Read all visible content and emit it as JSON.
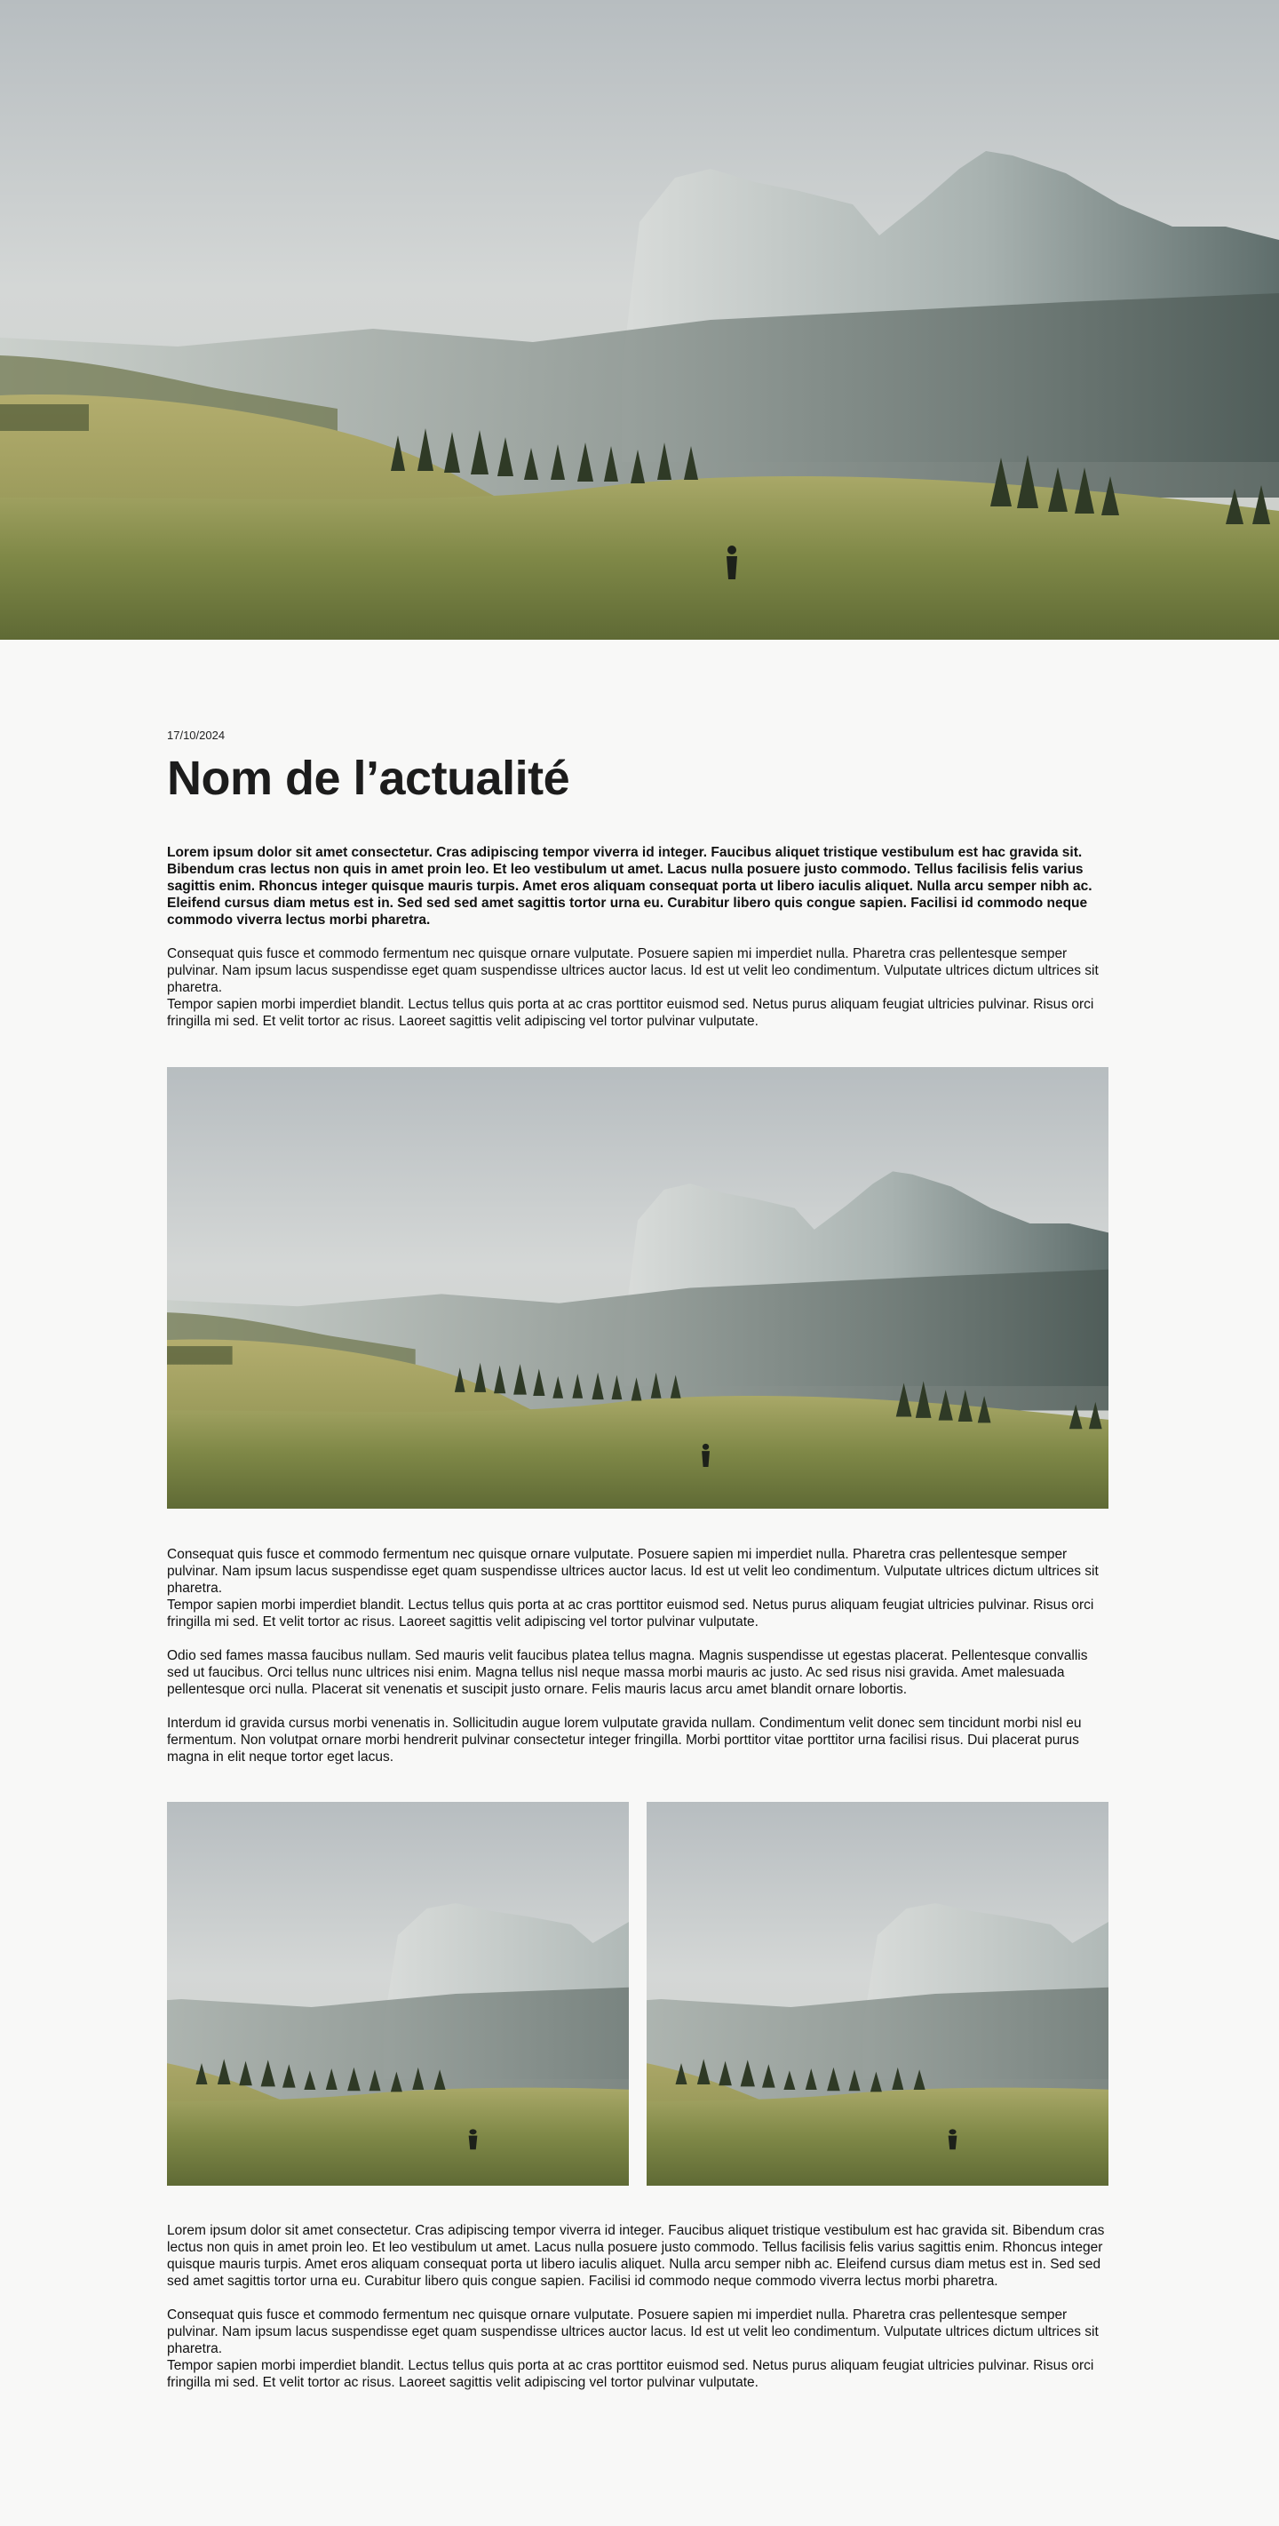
{
  "hero": {
    "image": "mountain-meadow-landscape-photo"
  },
  "article": {
    "date": "17/10/2024",
    "title": "Nom de l’actualité",
    "lead": "Lorem ipsum dolor sit amet consectetur. Cras adipiscing tempor viverra id integer. Faucibus aliquet tristique vestibulum est hac gravida sit. Bibendum cras lectus non quis in amet proin leo. Et leo vestibulum ut amet. Lacus nulla posuere justo commodo. Tellus facilisis felis varius sagittis enim. Rhoncus integer quisque mauris turpis. Amet eros aliquam consequat porta ut libero iaculis aliquet. Nulla arcu semper nibh ac. Eleifend cursus diam metus est in. Sed sed sed amet sagittis tortor urna eu. Curabitur libero quis congue sapien. Facilisi id commodo neque commodo viverra lectus morbi pharetra.",
    "block1": [
      "Consequat quis fusce et commodo fermentum nec quisque ornare vulputate. Posuere sapien mi imperdiet nulla. Pharetra cras pellentesque semper pulvinar. Nam ipsum lacus suspendisse eget quam suspendisse ultrices auctor lacus. Id est ut velit leo condimentum. Vulputate ultrices dictum ultrices sit pharetra.",
      "Tempor sapien morbi imperdiet blandit. Lectus tellus quis porta at ac cras porttitor euismod sed. Netus purus aliquam feugiat ultricies pulvinar. Risus orci fringilla mi sed. Et velit tortor ac risus. Laoreet sagittis velit adipiscing vel tortor pulvinar vulputate."
    ],
    "block2": [
      "Consequat quis fusce et commodo fermentum nec quisque ornare vulputate. Posuere sapien mi imperdiet nulla. Pharetra cras pellentesque semper pulvinar. Nam ipsum lacus suspendisse eget quam suspendisse ultrices auctor lacus. Id est ut velit leo condimentum. Vulputate ultrices dictum ultrices sit pharetra.",
      "Tempor sapien morbi imperdiet blandit. Lectus tellus quis porta at ac cras porttitor euismod sed. Netus purus aliquam feugiat ultricies pulvinar. Risus orci fringilla mi sed. Et velit tortor ac risus. Laoreet sagittis velit adipiscing vel tortor pulvinar vulputate.",
      "Odio sed fames massa faucibus nullam. Sed mauris velit faucibus platea tellus magna. Magnis suspendisse ut egestas placerat. Pellentesque convallis sed ut faucibus. Orci tellus nunc ultrices nisi enim. Magna tellus nisl neque massa morbi mauris ac justo. Ac sed risus nisi gravida. Amet malesuada pellentesque orci nulla. Placerat sit venenatis et suscipit justo ornare. Felis mauris lacus arcu amet blandit ornare lobortis.",
      "Interdum id gravida cursus morbi venenatis in. Sollicitudin augue lorem vulputate gravida nullam. Condimentum velit donec sem tincidunt morbi nisl eu fermentum. Non volutpat ornare morbi hendrerit pulvinar consectetur integer fringilla. Morbi porttitor vitae porttitor urna facilisi risus. Dui placerat purus magna in elit neque tortor eget lacus."
    ],
    "block3": [
      "Lorem ipsum dolor sit amet consectetur. Cras adipiscing tempor viverra id integer. Faucibus aliquet tristique vestibulum est hac gravida sit. Bibendum cras lectus non quis in amet proin leo. Et leo vestibulum ut amet. Lacus nulla posuere justo commodo. Tellus facilisis felis varius sagittis enim. Rhoncus integer quisque mauris turpis. Amet eros aliquam consequat porta ut libero iaculis aliquet. Nulla arcu semper nibh ac. Eleifend cursus diam metus est in. Sed sed sed amet sagittis tortor urna eu. Curabitur libero quis congue sapien. Facilisi id commodo neque commodo viverra lectus morbi pharetra.",
      "Consequat quis fusce et commodo fermentum nec quisque ornare vulputate. Posuere sapien mi imperdiet nulla. Pharetra cras pellentesque semper pulvinar. Nam ipsum lacus suspendisse eget quam suspendisse ultrices auctor lacus. Id est ut velit leo condimentum. Vulputate ultrices dictum ultrices sit pharetra.",
      "Tempor sapien morbi imperdiet blandit. Lectus tellus quis porta at ac cras porttitor euismod sed. Netus purus aliquam feugiat ultricies pulvinar. Risus orci fringilla mi sed. Et velit tortor ac risus. Laoreet sagittis velit adipiscing vel tortor pulvinar vulputate."
    ]
  },
  "colors": {
    "background": "#f8f8f7",
    "text": "#111111",
    "sky": "#c3c8cb",
    "meadow": "#8a8f4a",
    "mountain": "#6f7d7c"
  }
}
